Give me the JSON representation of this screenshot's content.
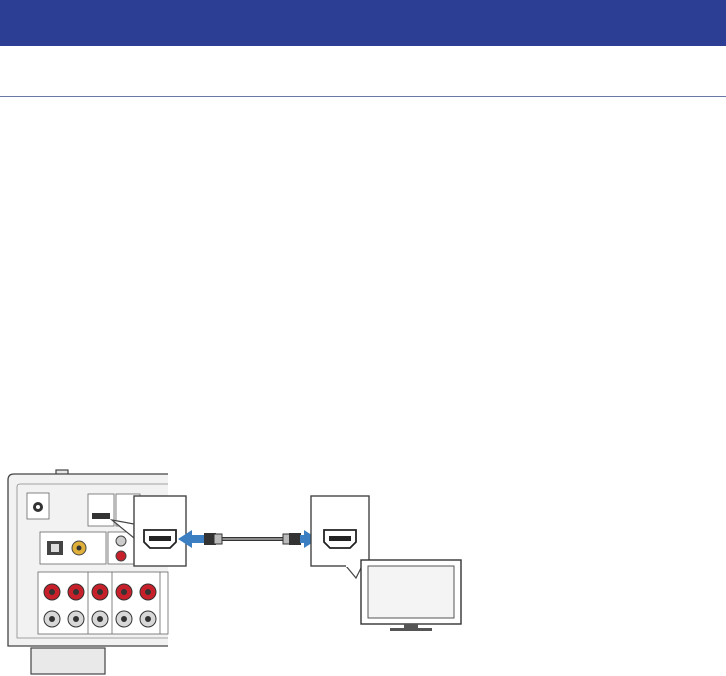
{
  "header": {
    "bar_color": "#2c3e94",
    "divider_color": "#6a78a8"
  },
  "diagram": {
    "subject": "hdmi-connection",
    "icons": [
      "av-receiver-rear-panel",
      "hdmi-port-callout",
      "hdmi-cable",
      "tv"
    ],
    "accent_color": "#3b7ec2",
    "speaker_terminal_color": "#c8202a"
  }
}
